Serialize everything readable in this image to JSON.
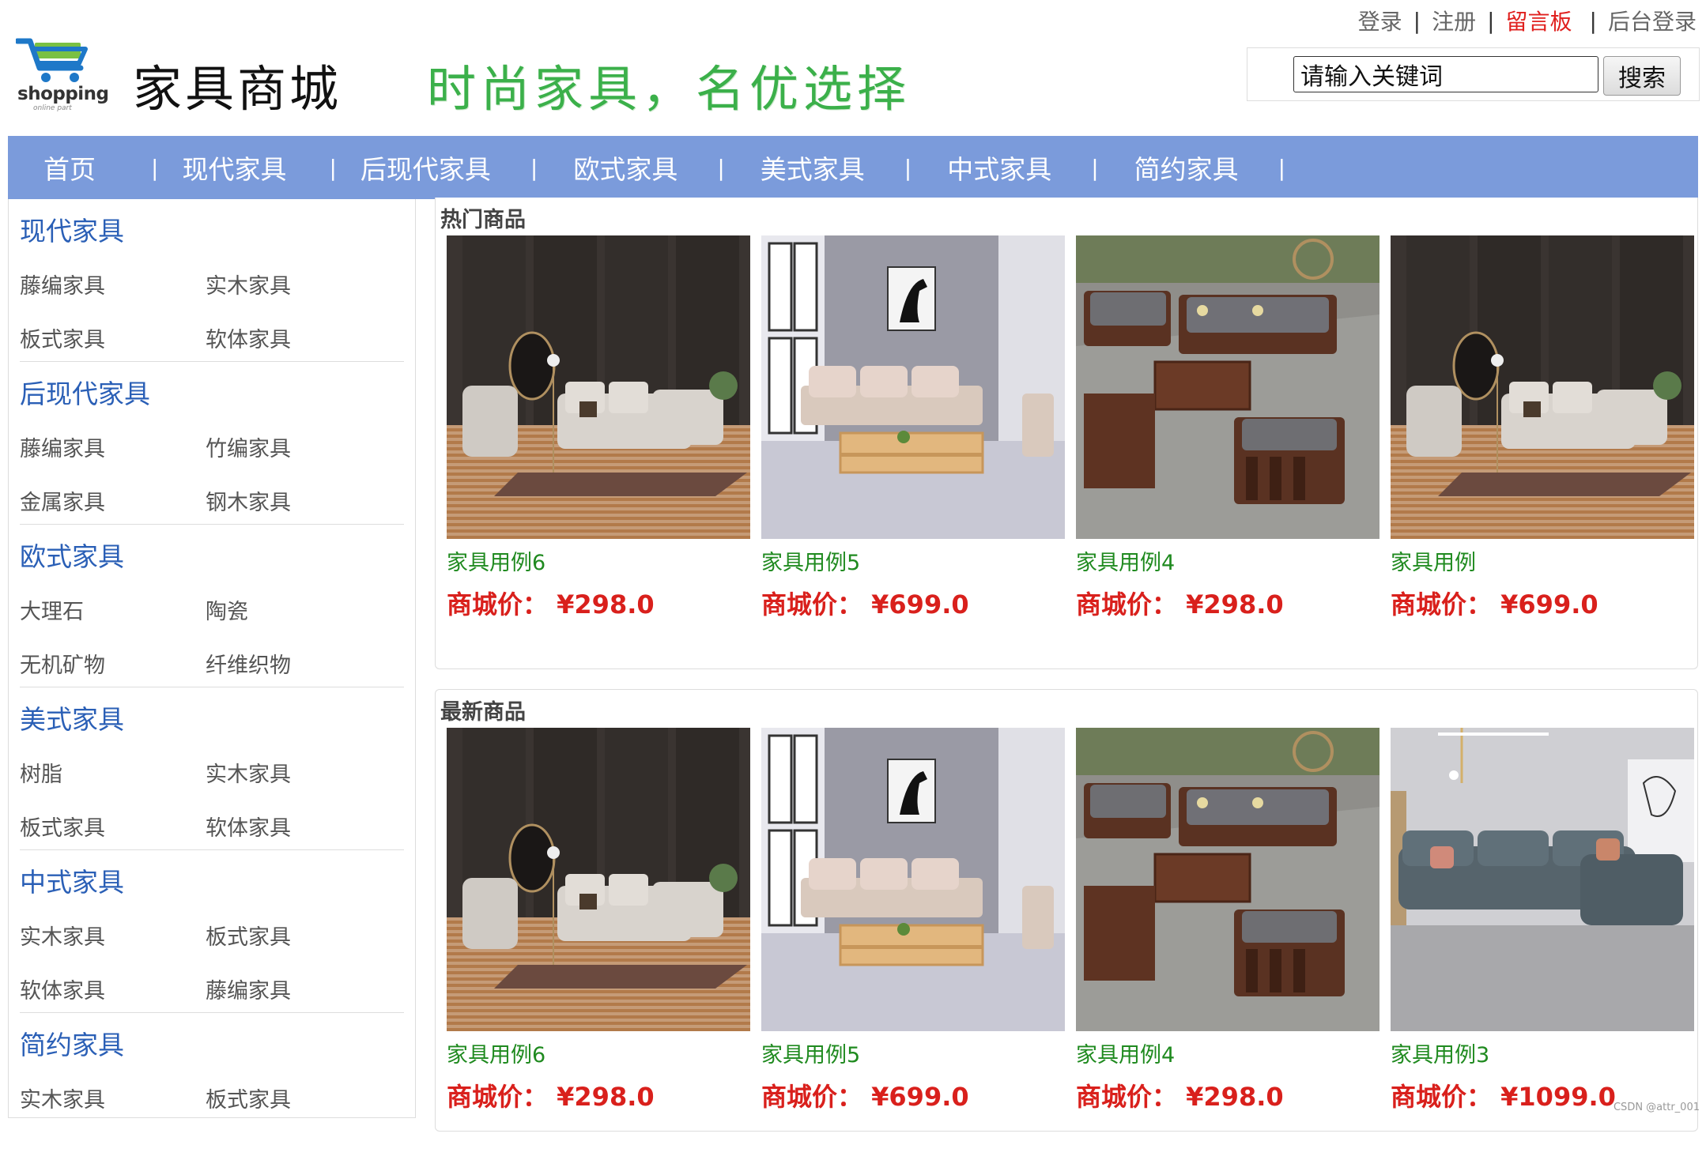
{
  "top_links": {
    "login": "登录",
    "register": "注册",
    "guestbook": "留言板",
    "admin_login": "后台登录"
  },
  "brand": {
    "logo_text": "shopping",
    "logo_subtext": "online part",
    "site_name": "家具商城",
    "slogan": "时尚家具，名优选择"
  },
  "search": {
    "value": "请输入关键词",
    "button": "搜索"
  },
  "nav": {
    "items": [
      "首页",
      "现代家具",
      "后现代家具",
      "欧式家具",
      "美式家具",
      "中式家具",
      "简约家具"
    ]
  },
  "sidebar": {
    "groups": [
      {
        "title": "现代家具",
        "subs": [
          "藤编家具",
          "实木家具",
          "板式家具",
          "软体家具"
        ]
      },
      {
        "title": "后现代家具",
        "subs": [
          "藤编家具",
          "竹编家具",
          "金属家具",
          "钢木家具"
        ]
      },
      {
        "title": "欧式家具",
        "subs": [
          "大理石",
          "陶瓷",
          "无机矿物",
          "纤维织物"
        ]
      },
      {
        "title": "美式家具",
        "subs": [
          "树脂",
          "实木家具",
          "板式家具",
          "软体家具"
        ]
      },
      {
        "title": "中式家具",
        "subs": [
          "实木家具",
          "板式家具",
          "软体家具",
          "藤编家具"
        ]
      },
      {
        "title": "简约家具",
        "subs": [
          "实木家具",
          "板式家具"
        ]
      }
    ]
  },
  "hot": {
    "title": "热门商品",
    "products": [
      {
        "name": "家具用例6",
        "price": "商城价：  ¥298.0",
        "image": "dark-room-sofa"
      },
      {
        "name": "家具用例5",
        "price": "商城价：  ¥699.0",
        "image": "wooden-sofa-zebra"
      },
      {
        "name": "家具用例4",
        "price": "商城价：  ¥298.0",
        "image": "walnut-sofa-set"
      },
      {
        "name": "家具用例",
        "price": "商城价：  ¥699.0",
        "image": "dark-room-sofa"
      }
    ]
  },
  "latest": {
    "title": "最新商品",
    "products": [
      {
        "name": "家具用例6",
        "price": "商城价：  ¥298.0",
        "image": "dark-room-sofa"
      },
      {
        "name": "家具用例5",
        "price": "商城价：  ¥699.0",
        "image": "wooden-sofa-zebra"
      },
      {
        "name": "家具用例4",
        "price": "商城价：  ¥298.0",
        "image": "walnut-sofa-set"
      },
      {
        "name": "家具用例3",
        "price": "商城价：  ¥1099.0",
        "image": "grey-sectional-sofa"
      }
    ]
  },
  "watermark": "CSDN @attr_001",
  "colors": {
    "nav_bg": "#7b9bdb",
    "category_blue": "#2a5fb6",
    "product_green": "#1f8a1f",
    "price_red": "#d9201c",
    "active_link": "#e0201e",
    "slogan_green": "#3bb04a"
  }
}
